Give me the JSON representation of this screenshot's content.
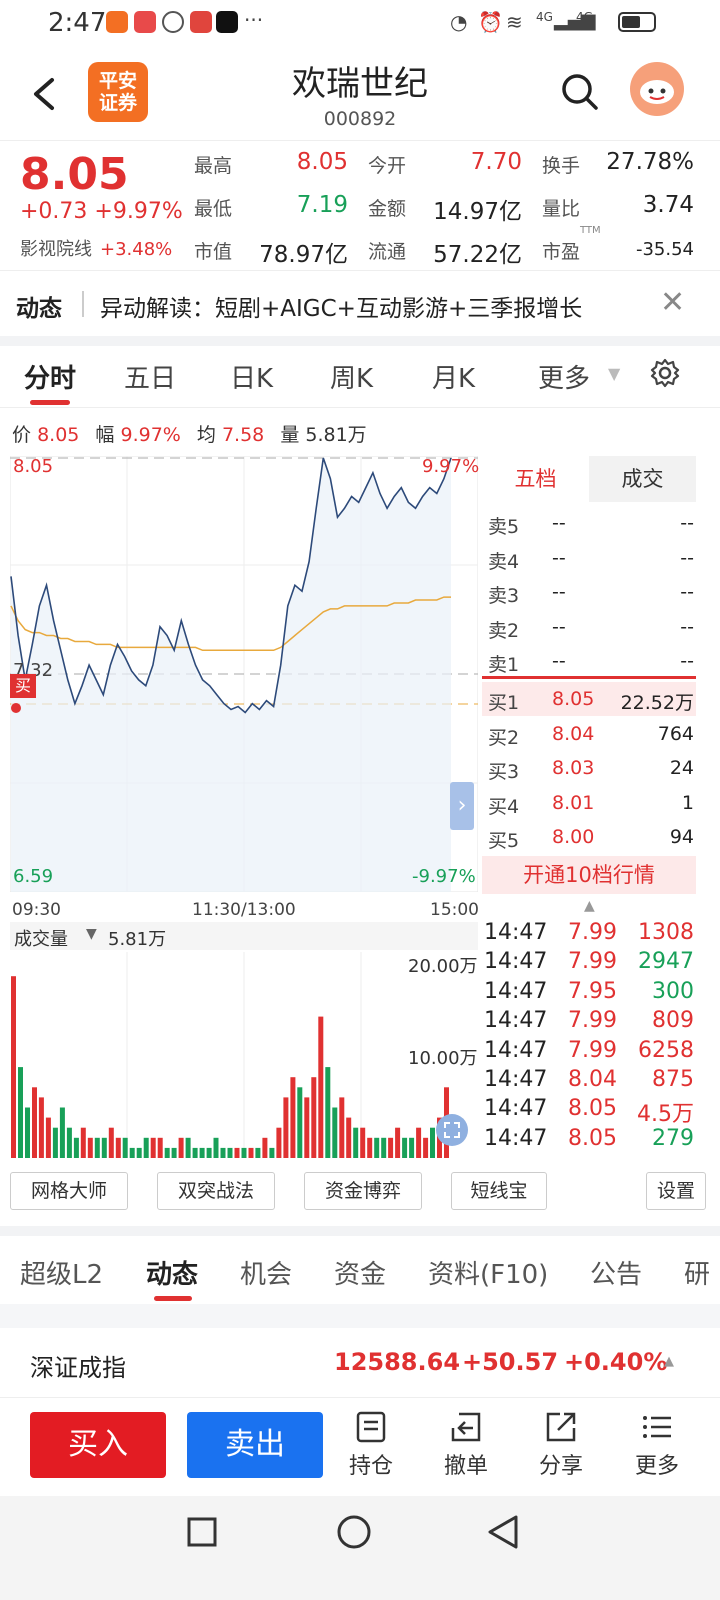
{
  "status": {
    "time": "2:47",
    "dots": "···",
    "net1": "4G",
    "net2": "4G"
  },
  "header": {
    "logo_line1": "平安",
    "logo_line2": "证券",
    "name": "欢瑞世纪",
    "code": "000892"
  },
  "quote": {
    "price": "8.05",
    "change": "+0.73",
    "change_pct": "+9.97%",
    "sector_name": "影视院线",
    "sector_pct": "+3.48%",
    "fields": [
      {
        "label": "最高",
        "value": "8.05"
      },
      {
        "label": "今开",
        "value": "7.70"
      },
      {
        "label": "换手",
        "value": "27.78%"
      },
      {
        "label": "最低",
        "value": "7.19"
      },
      {
        "label": "金额",
        "value": "14.97亿"
      },
      {
        "label": "量比",
        "value": "3.74"
      },
      {
        "label": "市值",
        "value": "78.97亿"
      },
      {
        "label": "流通",
        "value": "57.22亿"
      },
      {
        "label": "市盈",
        "value": "-35.54",
        "sup": "TTM"
      }
    ]
  },
  "news": {
    "tag": "动态",
    "text": "异动解读：短剧+AIGC+互动影游+三季报增长"
  },
  "chart_tabs": [
    "分时",
    "五日",
    "日K",
    "周K",
    "月K",
    "更多"
  ],
  "chart_info": {
    "l1": "价",
    "v1": "8.05",
    "l2": "幅",
    "v2": "9.97%",
    "l3": "均",
    "v3": "7.58",
    "l4": "量",
    "v4": "5.81万"
  },
  "chart": {
    "top_price": "8.05",
    "top_pct": "9.97%",
    "mid_price": "7.32",
    "low_price": "6.59",
    "low_pct": "-9.97%",
    "buy_marker": "买",
    "t_start": "09:30",
    "t_mid": "11:30/13:00",
    "t_end": "15:00",
    "vol_label": "成交量",
    "vol_value": "5.81万",
    "vol_tick_hi": "20.00万",
    "vol_tick_mid": "10.00万"
  },
  "orderbook": {
    "tab_active": "五档",
    "tab_other": "成交",
    "asks": [
      {
        "label": "卖5",
        "price": "--",
        "vol": "--"
      },
      {
        "label": "卖4",
        "price": "--",
        "vol": "--"
      },
      {
        "label": "卖3",
        "price": "--",
        "vol": "--"
      },
      {
        "label": "卖2",
        "price": "--",
        "vol": "--"
      },
      {
        "label": "卖1",
        "price": "--",
        "vol": "--"
      }
    ],
    "bids": [
      {
        "label": "买1",
        "price": "8.05",
        "vol": "22.52万"
      },
      {
        "label": "买2",
        "price": "8.04",
        "vol": "764"
      },
      {
        "label": "买3",
        "price": "8.03",
        "vol": "24"
      },
      {
        "label": "买4",
        "price": "8.01",
        "vol": "1"
      },
      {
        "label": "买5",
        "price": "8.00",
        "vol": "94"
      }
    ],
    "open10": "开通10档行情"
  },
  "ticks": [
    {
      "t": "14:47",
      "p": "7.99",
      "v": "1308",
      "dir": "up"
    },
    {
      "t": "14:47",
      "p": "7.99",
      "v": "2947",
      "dir": "down"
    },
    {
      "t": "14:47",
      "p": "7.95",
      "v": "300",
      "dir": "down"
    },
    {
      "t": "14:47",
      "p": "7.99",
      "v": "809",
      "dir": "up"
    },
    {
      "t": "14:47",
      "p": "7.99",
      "v": "6258",
      "dir": "up"
    },
    {
      "t": "14:47",
      "p": "8.04",
      "v": "875",
      "dir": "up"
    },
    {
      "t": "14:47",
      "p": "8.05",
      "v": "4.5万",
      "dir": "up"
    },
    {
      "t": "14:47",
      "p": "8.05",
      "v": "279",
      "dir": "down"
    }
  ],
  "tools": [
    "网格大师",
    "双突战法",
    "资金博弈",
    "短线宝",
    "设置"
  ],
  "footer_tabs": [
    "超级L2",
    "动态",
    "机会",
    "资金",
    "资料(F10)",
    "公告",
    "研"
  ],
  "index": {
    "name": "深证成指",
    "value": "12588.64",
    "change": "+50.57",
    "pct": "+0.40%"
  },
  "actions": {
    "buy": "买入",
    "sell": "卖出",
    "hold": "持仓",
    "cancel": "撤单",
    "share": "分享",
    "more": "更多"
  },
  "chart_data": {
    "type": "line",
    "x_labels": [
      "09:30",
      "11:30/13:00",
      "15:00"
    ],
    "y_range": [
      6.59,
      8.05
    ],
    "prev_close": 7.32,
    "series": [
      {
        "values": [
          7.65,
          7.45,
          7.3,
          7.42,
          7.55,
          7.62,
          7.5,
          7.4,
          7.3,
          7.22,
          7.28,
          7.35,
          7.3,
          7.25,
          7.35,
          7.42,
          7.38,
          7.33,
          7.3,
          7.28,
          7.35,
          7.48,
          7.45,
          7.4,
          7.5,
          7.42,
          7.35,
          7.3,
          7.28,
          7.25,
          7.22,
          7.2,
          7.21,
          7.19,
          7.22,
          7.2,
          7.23,
          7.21,
          7.35,
          7.55,
          7.62,
          7.6,
          7.7,
          7.88,
          8.05,
          7.98,
          7.85,
          7.88,
          7.92,
          7.9,
          7.95,
          8.0,
          7.93,
          7.88,
          7.92,
          7.95,
          7.9,
          7.88,
          7.92,
          7.95,
          7.93,
          7.98,
          8.05
        ]
      },
      {
        "values": [
          7.55,
          7.5,
          7.47,
          7.46,
          7.46,
          7.45,
          7.45,
          7.44,
          7.44,
          7.43,
          7.43,
          7.43,
          7.42,
          7.42,
          7.42,
          7.41,
          7.41,
          7.41,
          7.41,
          7.41,
          7.41,
          7.41,
          7.41,
          7.41,
          7.41,
          7.41,
          7.41,
          7.4,
          7.4,
          7.4,
          7.4,
          7.4,
          7.4,
          7.4,
          7.4,
          7.4,
          7.4,
          7.4,
          7.41,
          7.43,
          7.45,
          7.47,
          7.49,
          7.51,
          7.53,
          7.54,
          7.54,
          7.55,
          7.55,
          7.55,
          7.55,
          7.55,
          7.55,
          7.55,
          7.56,
          7.56,
          7.56,
          7.57,
          7.57,
          7.57,
          7.57,
          7.58,
          7.58
        ]
      }
    ],
    "volume": [
      18,
      9,
      5,
      7,
      6,
      4,
      3,
      5,
      3,
      2,
      3,
      2,
      2,
      2,
      3,
      2,
      2,
      1,
      1,
      2,
      2,
      2,
      1,
      1,
      2,
      2,
      1,
      1,
      1,
      2,
      1,
      1,
      1,
      1,
      1,
      1,
      2,
      1,
      3,
      6,
      8,
      7,
      6,
      8,
      14,
      9,
      5,
      6,
      4,
      3,
      3,
      2,
      2,
      2,
      2,
      3,
      2,
      2,
      3,
      2,
      3,
      4,
      7
    ],
    "volume_max": 20
  }
}
